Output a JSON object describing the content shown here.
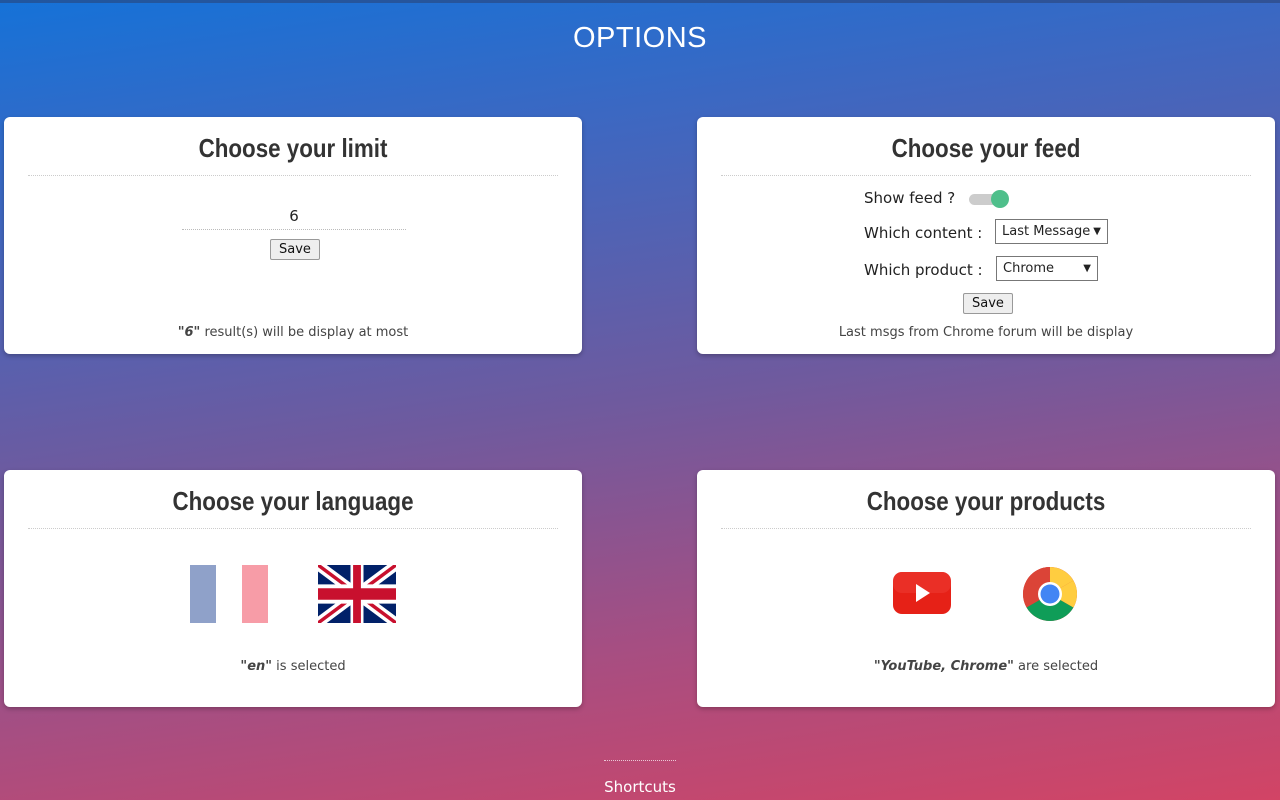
{
  "page": {
    "title": "OPTIONS"
  },
  "limit_card": {
    "title": "Choose your limit",
    "input_value": "6",
    "save_label": "Save",
    "status_value": "\"6\"",
    "status_text": " result(s) will be display at most"
  },
  "feed_card": {
    "title": "Choose your feed",
    "show_feed_label": "Show feed ?",
    "show_feed_on": true,
    "toggle_color": "#4fbf8b",
    "content_label": "Which content :",
    "content_selected": "Last Message",
    "product_label": "Which product :",
    "product_selected": "Chrome",
    "save_label": "Save",
    "status_text": "Last msgs from Chrome forum will be display"
  },
  "language_card": {
    "title": "Choose your language",
    "flags": [
      "french-flag-icon",
      "uk-flag-icon"
    ],
    "status_value": "\"en\"",
    "status_text": " is selected"
  },
  "products_card": {
    "title": "Choose your products",
    "products": [
      "youtube-icon",
      "chrome-icon"
    ],
    "status_value": "\"YouTube, Chrome\"",
    "status_text": " are selected"
  },
  "footer": {
    "shortcuts_label": "Shortcuts"
  }
}
